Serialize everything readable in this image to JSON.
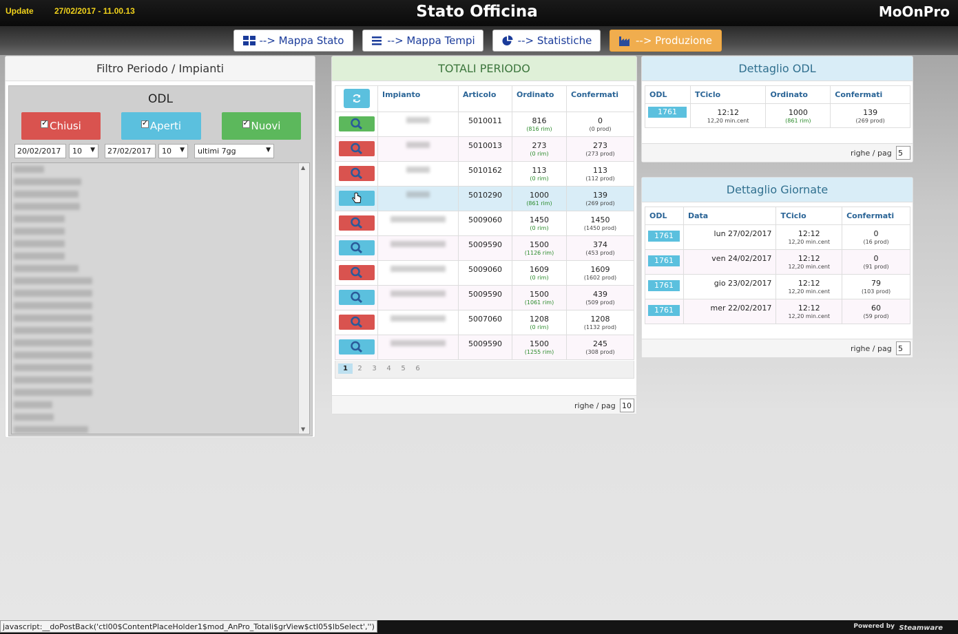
{
  "header": {
    "update_label": "Update",
    "update_time": "27/02/2017 - 11.00.13",
    "title": "Stato Officina",
    "brand": "MoOnPro"
  },
  "nav": {
    "items": [
      {
        "label": "--> Mappa Stato",
        "icon": "grid-icon"
      },
      {
        "label": "--> Mappa Tempi",
        "icon": "list-icon"
      },
      {
        "label": "--> Statistiche",
        "icon": "pie-chart-icon"
      },
      {
        "label": "--> Produzione",
        "icon": "factory-icon",
        "active": true
      }
    ]
  },
  "filter": {
    "title": "Filtro Periodo / Impianti",
    "odl_title": "ODL",
    "buttons": [
      {
        "label": "Chiusi",
        "checked": true,
        "color": "#d9534f"
      },
      {
        "label": "Aperti",
        "checked": true,
        "color": "#5bc0de"
      },
      {
        "label": "Nuovi",
        "checked": true,
        "color": "#5cb85c"
      }
    ],
    "date_from": "20/02/2017",
    "hour_from": "10",
    "date_to": "27/02/2017",
    "hour_to": "10",
    "range": "ultimi 7gg"
  },
  "totali": {
    "title": "TOTALI PERIODO",
    "columns": [
      "Impianto",
      "Articolo",
      "Ordinato",
      "Confermati"
    ],
    "rows": [
      {
        "btn": "green",
        "articolo": "5010011",
        "ordinato": "816",
        "ord_sub": "(816 rim)",
        "confermati": "0",
        "conf_sub": "(0 prod)"
      },
      {
        "btn": "red",
        "articolo": "5010013",
        "ordinato": "273",
        "ord_sub": "(0 rim)",
        "confermati": "273",
        "conf_sub": "(273 prod)"
      },
      {
        "btn": "red",
        "articolo": "5010162",
        "ordinato": "113",
        "ord_sub": "(0 rim)",
        "confermati": "113",
        "conf_sub": "(112 prod)"
      },
      {
        "btn": "cyan",
        "articolo": "5010290",
        "ordinato": "1000",
        "ord_sub": "(861 rim)",
        "confermati": "139",
        "conf_sub": "(269 prod)",
        "highlight": true
      },
      {
        "btn": "red",
        "articolo": "5009060",
        "ordinato": "1450",
        "ord_sub": "(0 rim)",
        "confermati": "1450",
        "conf_sub": "(1450 prod)"
      },
      {
        "btn": "cyan",
        "articolo": "5009590",
        "ordinato": "1500",
        "ord_sub": "(1126 rim)",
        "confermati": "374",
        "conf_sub": "(453 prod)"
      },
      {
        "btn": "red",
        "articolo": "5009060",
        "ordinato": "1609",
        "ord_sub": "(0 rim)",
        "confermati": "1609",
        "conf_sub": "(1602 prod)"
      },
      {
        "btn": "cyan",
        "articolo": "5009590",
        "ordinato": "1500",
        "ord_sub": "(1061 rim)",
        "confermati": "439",
        "conf_sub": "(509 prod)"
      },
      {
        "btn": "red",
        "articolo": "5007060",
        "ordinato": "1208",
        "ord_sub": "(0 rim)",
        "confermati": "1208",
        "conf_sub": "(1132 prod)"
      },
      {
        "btn": "cyan",
        "articolo": "5009590",
        "ordinato": "1500",
        "ord_sub": "(1255 rim)",
        "confermati": "245",
        "conf_sub": "(308 prod)"
      }
    ],
    "pages": [
      "1",
      "2",
      "3",
      "4",
      "5",
      "6"
    ],
    "rpp_label": "righe / pag",
    "rpp_value": "10"
  },
  "dettaglio_odl": {
    "title": "Dettaglio ODL",
    "columns": [
      "ODL",
      "TCiclo",
      "Ordinato",
      "Confermati"
    ],
    "row": {
      "odl": "1761",
      "tciclo": "12:12",
      "tciclo_sub": "12,20 min.cent",
      "ordinato": "1000",
      "ord_sub": "(861 rim)",
      "confermati": "139",
      "conf_sub": "(269 prod)"
    },
    "rpp_label": "righe / pag",
    "rpp_value": "5"
  },
  "dettaglio_giornate": {
    "title": "Dettaglio Giornate",
    "columns": [
      "ODL",
      "Data",
      "TCiclo",
      "Confermati"
    ],
    "rows": [
      {
        "odl": "1761",
        "data": "lun 27/02/2017",
        "tciclo": "12:12",
        "tciclo_sub": "12,20 min.cent",
        "confermati": "0",
        "conf_sub": "(16 prod)"
      },
      {
        "odl": "1761",
        "data": "ven 24/02/2017",
        "tciclo": "12:12",
        "tciclo_sub": "12,20 min.cent",
        "confermati": "0",
        "conf_sub": "(91 prod)"
      },
      {
        "odl": "1761",
        "data": "gio 23/02/2017",
        "tciclo": "12:12",
        "tciclo_sub": "12,20 min.cent",
        "confermati": "79",
        "conf_sub": "(103 prod)"
      },
      {
        "odl": "1761",
        "data": "mer 22/02/2017",
        "tciclo": "12:12",
        "tciclo_sub": "12,20 min.cent",
        "confermati": "60",
        "conf_sub": "(59 prod)"
      }
    ],
    "rpp_label": "righe / pag",
    "rpp_value": "5"
  },
  "statusbar": {
    "url": "javascript:__doPostBack('ctl00$ContentPlaceHolder1$mod_AnPro_Totali$grView$ctl05$lbSelect','')",
    "powered": "Powered by",
    "vendor": "Steamware"
  }
}
